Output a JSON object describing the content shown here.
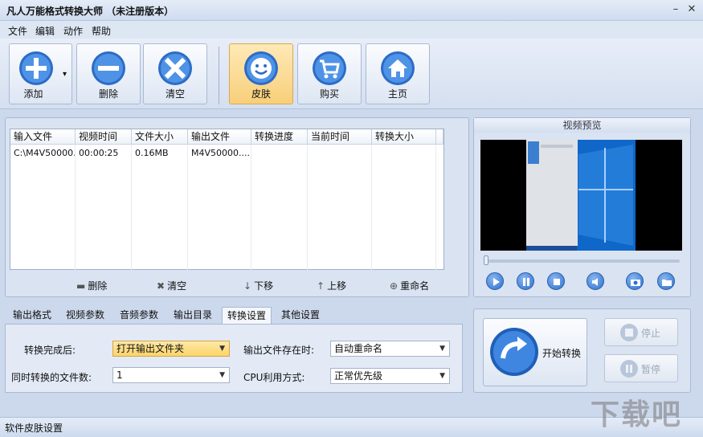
{
  "app": {
    "title": "凡人万能格式转换大师 （未注册版本）",
    "minimize_glyph": "–",
    "close_glyph": "✕"
  },
  "menu": [
    "文件",
    "编辑",
    "动作",
    "帮助"
  ],
  "toolbar": {
    "add": "添加",
    "delete": "删除",
    "clear": "清空",
    "skin": "皮肤",
    "buy": "购买",
    "home": "主页",
    "dropdown_glyph": "▾"
  },
  "file_table": {
    "columns": [
      "输入文件",
      "视频时间",
      "文件大小",
      "输出文件",
      "转换进度",
      "当前时间",
      "转换大小"
    ],
    "rows": [
      [
        "C:\\M4V50000...",
        "00:00:25",
        "0.16MB",
        "M4V50000....",
        "",
        "",
        ""
      ]
    ]
  },
  "list_actions": {
    "delete": "删除",
    "clear": "清空",
    "move_down": "下移",
    "move_up": "上移",
    "rename": "重命名"
  },
  "preview": {
    "title": "视频预览"
  },
  "tabs": [
    "输出格式",
    "视频参数",
    "音频参数",
    "输出目录",
    "转换设置",
    "其他设置"
  ],
  "settings": {
    "after_complete_label": "转换完成后:",
    "after_complete_value": "打开输出文件夹",
    "exists_label": "输出文件存在时:",
    "exists_value": "自动重命名",
    "concurrent_label": "同时转换的文件数:",
    "concurrent_value": "1",
    "cpu_label": "CPU利用方式:",
    "cpu_value": "正常优先级"
  },
  "convert": {
    "start": "开始转换",
    "stop": "停止",
    "pause": "暂停"
  },
  "status": {
    "text": "软件皮肤设置"
  },
  "watermark": {
    "text": "下载吧"
  },
  "colors": {
    "accent_blue": "#2b6fd0",
    "skin_highlight": "#f8cf7a",
    "window_bg": "#ccd8ec"
  },
  "icons": {
    "add": "plus-circle-icon",
    "delete": "minus-circle-icon",
    "clear": "x-circle-icon",
    "skin": "smiley-icon",
    "buy": "cart-icon",
    "home": "house-icon",
    "start": "refresh-arrow-icon",
    "stop": "stop-icon",
    "pause": "pause-icon",
    "remove_item": "dash-icon",
    "clear_list": "x-icon",
    "down": "arrow-down-icon",
    "up": "arrow-up-icon",
    "rename": "crosshair-icon",
    "play": "play-icon",
    "pause_play": "pause-icon",
    "stop_play": "stop-icon",
    "volume": "speaker-icon",
    "snapshot": "camera-icon",
    "folder": "folder-icon"
  }
}
